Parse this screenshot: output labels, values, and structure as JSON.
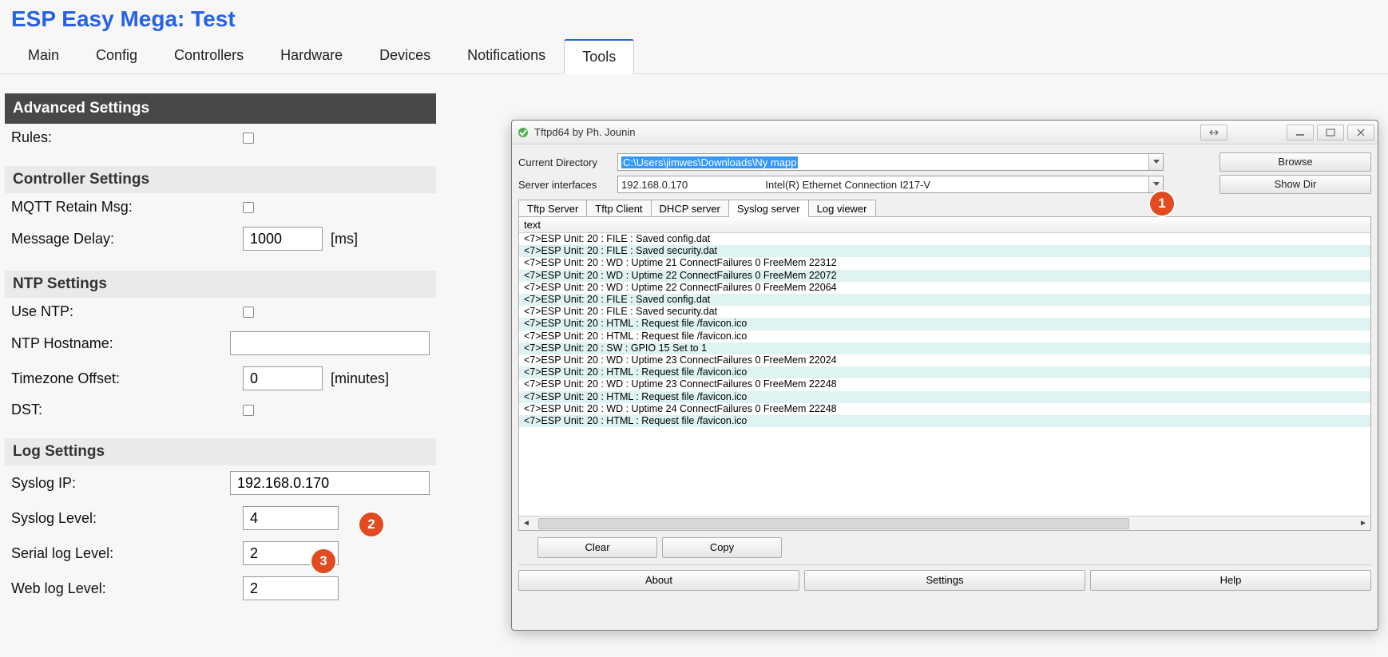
{
  "esp": {
    "title": "ESP Easy Mega: Test",
    "tabs": [
      "Main",
      "Config",
      "Controllers",
      "Hardware",
      "Devices",
      "Notifications",
      "Tools"
    ],
    "active_tab": 6,
    "hdr_advanced": "Advanced Settings",
    "lbl_rules": "Rules:",
    "hdr_controller": "Controller Settings",
    "lbl_mqtt": "MQTT Retain Msg:",
    "lbl_msgdelay": "Message Delay:",
    "val_msgdelay": "1000",
    "unit_ms": "[ms]",
    "hdr_ntp": "NTP Settings",
    "lbl_usentp": "Use NTP:",
    "lbl_ntphost": "NTP Hostname:",
    "val_ntphost": "",
    "lbl_tz": "Timezone Offset:",
    "val_tz": "0",
    "unit_min": "[minutes]",
    "lbl_dst": "DST:",
    "hdr_log": "Log Settings",
    "lbl_syslogip": "Syslog IP:",
    "val_syslogip": "192.168.0.170",
    "lbl_sysloglvl": "Syslog Level:",
    "val_sysloglvl": "4",
    "lbl_seriallvl": "Serial log Level:",
    "val_seriallvl": "2",
    "lbl_weblvl": "Web log Level:",
    "val_weblvl": "2"
  },
  "markers": {
    "m1": "1",
    "m2": "2",
    "m3": "3"
  },
  "tftpd": {
    "title": "Tftpd64 by Ph. Jounin",
    "lbl_curdir": "Current Directory",
    "val_curdir": "C:\\Users\\jimwes\\Downloads\\Ny mapp",
    "lbl_iface": "Server interfaces",
    "val_iface_ip": "192.168.0.170",
    "val_iface_desc": "Intel(R) Ethernet Connection I217-V",
    "btn_browse": "Browse",
    "btn_showdir": "Show Dir",
    "tabs": [
      "Tftp Server",
      "Tftp Client",
      "DHCP server",
      "Syslog server",
      "Log viewer"
    ],
    "active_tab": 3,
    "list_hdr": "text",
    "lines": [
      "<7>ESP Unit: 20 : FILE : Saved config.dat",
      "<7>ESP Unit: 20 : FILE : Saved security.dat",
      "<7>ESP Unit: 20 : WD   : Uptime 21 ConnectFailures 0 FreeMem 22312",
      "<7>ESP Unit: 20 : WD   : Uptime 22 ConnectFailures 0 FreeMem 22072",
      "<7>ESP Unit: 20 : WD   : Uptime 22 ConnectFailures 0 FreeMem 22064",
      "<7>ESP Unit: 20 : FILE : Saved config.dat",
      "<7>ESP Unit: 20 : FILE : Saved security.dat",
      "<7>ESP Unit: 20 : HTML : Request file /favicon.ico",
      "<7>ESP Unit: 20 : HTML : Request file /favicon.ico",
      "<7>ESP Unit: 20 : SW   : GPIO 15 Set to 1",
      "<7>ESP Unit: 20 : WD   : Uptime 23 ConnectFailures 0 FreeMem 22024",
      "<7>ESP Unit: 20 : HTML : Request file /favicon.ico",
      "<7>ESP Unit: 20 : WD   : Uptime 23 ConnectFailures 0 FreeMem 22248",
      "<7>ESP Unit: 20 : HTML : Request file /favicon.ico",
      "<7>ESP Unit: 20 : WD   : Uptime 24 ConnectFailures 0 FreeMem 22248",
      "<7>ESP Unit: 20 : HTML : Request file /favicon.ico"
    ],
    "btn_clear": "Clear",
    "btn_copy": "Copy",
    "btn_about": "About",
    "btn_settings": "Settings",
    "btn_help": "Help"
  }
}
